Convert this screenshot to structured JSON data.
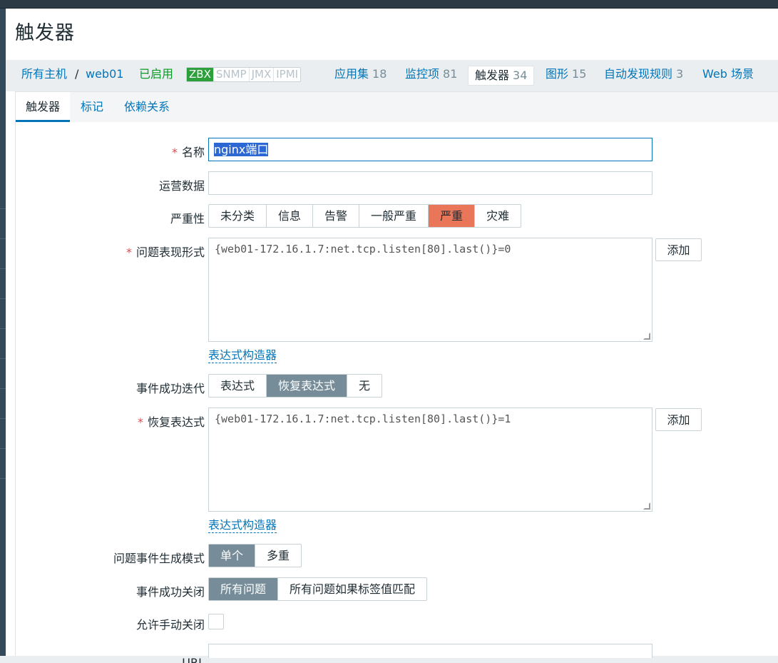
{
  "page": {
    "title": "触发器"
  },
  "host_nav": {
    "all_hosts": "所有主机",
    "separator": "/",
    "host": "web01",
    "status": "已启用",
    "availability": [
      {
        "label": "ZBX",
        "active": true
      },
      {
        "label": "SNMP",
        "active": false
      },
      {
        "label": "JMX",
        "active": false
      },
      {
        "label": "IPMI",
        "active": false
      }
    ],
    "links": [
      {
        "label": "应用集",
        "count": "18"
      },
      {
        "label": "监控项",
        "count": "81"
      },
      {
        "label": "触发器",
        "count": "34",
        "active": true
      },
      {
        "label": "图形",
        "count": "15"
      },
      {
        "label": "自动发现规则",
        "count": "3"
      },
      {
        "label": "Web 场景",
        "count": ""
      }
    ]
  },
  "tabs": [
    {
      "label": "触发器",
      "active": true
    },
    {
      "label": "标记",
      "active": false
    },
    {
      "label": "依赖关系",
      "active": false
    }
  ],
  "form": {
    "name": {
      "label": "名称",
      "required": true,
      "value": "nginx端口"
    },
    "opdata": {
      "label": "运营数据",
      "value": ""
    },
    "severity": {
      "label": "严重性",
      "options": [
        "未分类",
        "信息",
        "告警",
        "一般严重",
        "严重",
        "灾难"
      ],
      "selected": "严重",
      "selected_color": "#e97659"
    },
    "expression": {
      "label": "问题表现形式",
      "required": true,
      "value": "{web01-172.16.1.7:net.tcp.listen[80].last()}=0",
      "add_button": "添加",
      "constructor_link": "表达式构造器"
    },
    "recovery_mode": {
      "label": "事件成功迭代",
      "options": [
        "表达式",
        "恢复表达式",
        "无"
      ],
      "selected": "恢复表达式"
    },
    "recovery_expression": {
      "label": "恢复表达式",
      "required": true,
      "value": "{web01-172.16.1.7:net.tcp.listen[80].last()}=1",
      "add_button": "添加",
      "constructor_link": "表达式构造器"
    },
    "problem_mode": {
      "label": "问题事件生成模式",
      "options": [
        "单个",
        "多重"
      ],
      "selected": "单个"
    },
    "ok_close": {
      "label": "事件成功关闭",
      "options": [
        "所有问题",
        "所有问题如果标签值匹配"
      ],
      "selected": "所有问题"
    },
    "manual_close": {
      "label": "允许手动关闭",
      "checked": false
    },
    "url": {
      "label": "URL",
      "value": ""
    }
  },
  "colors": {
    "link": "#0275b8",
    "enabled": "#0a9a25",
    "selected": "#768d99",
    "required": "#d64e4e"
  }
}
